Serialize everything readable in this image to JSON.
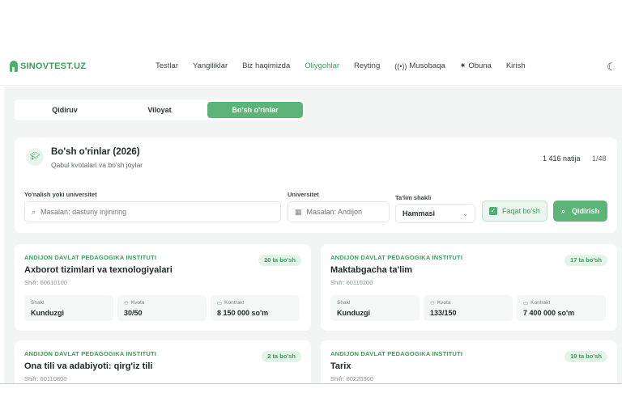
{
  "header": {
    "logo": "SINOVTEST.UZ",
    "nav": [
      {
        "label": "Testlar",
        "icon": ""
      },
      {
        "label": "Yangiliklar",
        "icon": ""
      },
      {
        "label": "Biz haqimizda",
        "icon": ""
      },
      {
        "label": "Oliygohlar",
        "icon": "",
        "active": true
      },
      {
        "label": "Reyting",
        "icon": ""
      },
      {
        "label": "Musobaqa",
        "icon": "broadcast-icon"
      },
      {
        "label": "Obuna",
        "icon": "sparkle-icon"
      },
      {
        "label": "Kirish",
        "icon": ""
      }
    ],
    "theme_icon": "moon-icon"
  },
  "tabs": [
    {
      "label": "Qidiruv"
    },
    {
      "label": "Viloyat"
    },
    {
      "label": "Bo'sh o'rinlar",
      "active": true
    }
  ],
  "filter": {
    "title": "Bo'sh o'rinlar (2026)",
    "subtitle": "Qabul kvotalari va bo'sh joylar",
    "results": "1 416 natija",
    "page": "1/48",
    "direction_label": "Yo'nalish yoki universitet",
    "direction_placeholder": "Masalan: dasturiy injiniring",
    "university_label": "Universitet",
    "university_placeholder": "Masalan: Andijon",
    "form_label": "Ta'lim shakli",
    "form_value": "Hammasi",
    "only_empty_label": "Faqat bo'sh",
    "search_button": "Qidirish"
  },
  "stat_labels": {
    "form": "Shakl",
    "quota": "Kvota",
    "contract": "Kontrakt"
  },
  "cards": [
    {
      "institution": "ANDIJON DAVLAT PEDAGOGIKA INSTITUTI",
      "badge": "20 ta bo'sh",
      "title": "Axborot tizimlari va texnologiyalari",
      "code": "Shifr: 60610100",
      "form": "Kunduzgi",
      "quota": "30/50",
      "contract": "8 150 000 so'm"
    },
    {
      "institution": "ANDIJON DAVLAT PEDAGOGIKA INSTITUTI",
      "badge": "17 ta bo'sh",
      "title": "Maktabgacha ta'lim",
      "code": "Shifr: 60110200",
      "form": "Kunduzgi",
      "quota": "133/150",
      "contract": "7 400 000 so'm"
    },
    {
      "institution": "ANDIJON DAVLAT PEDAGOGIKA INSTITUTI",
      "badge": "2 ta bo'sh",
      "title": "Ona tili va adabiyoti: qirg'iz tili",
      "code": "Shifr: 60110800"
    },
    {
      "institution": "ANDIJON DAVLAT PEDAGOGIKA INSTITUTI",
      "badge": "19 ta bo'sh",
      "title": "Tarix",
      "code": "Shifr: 60220300"
    }
  ]
}
